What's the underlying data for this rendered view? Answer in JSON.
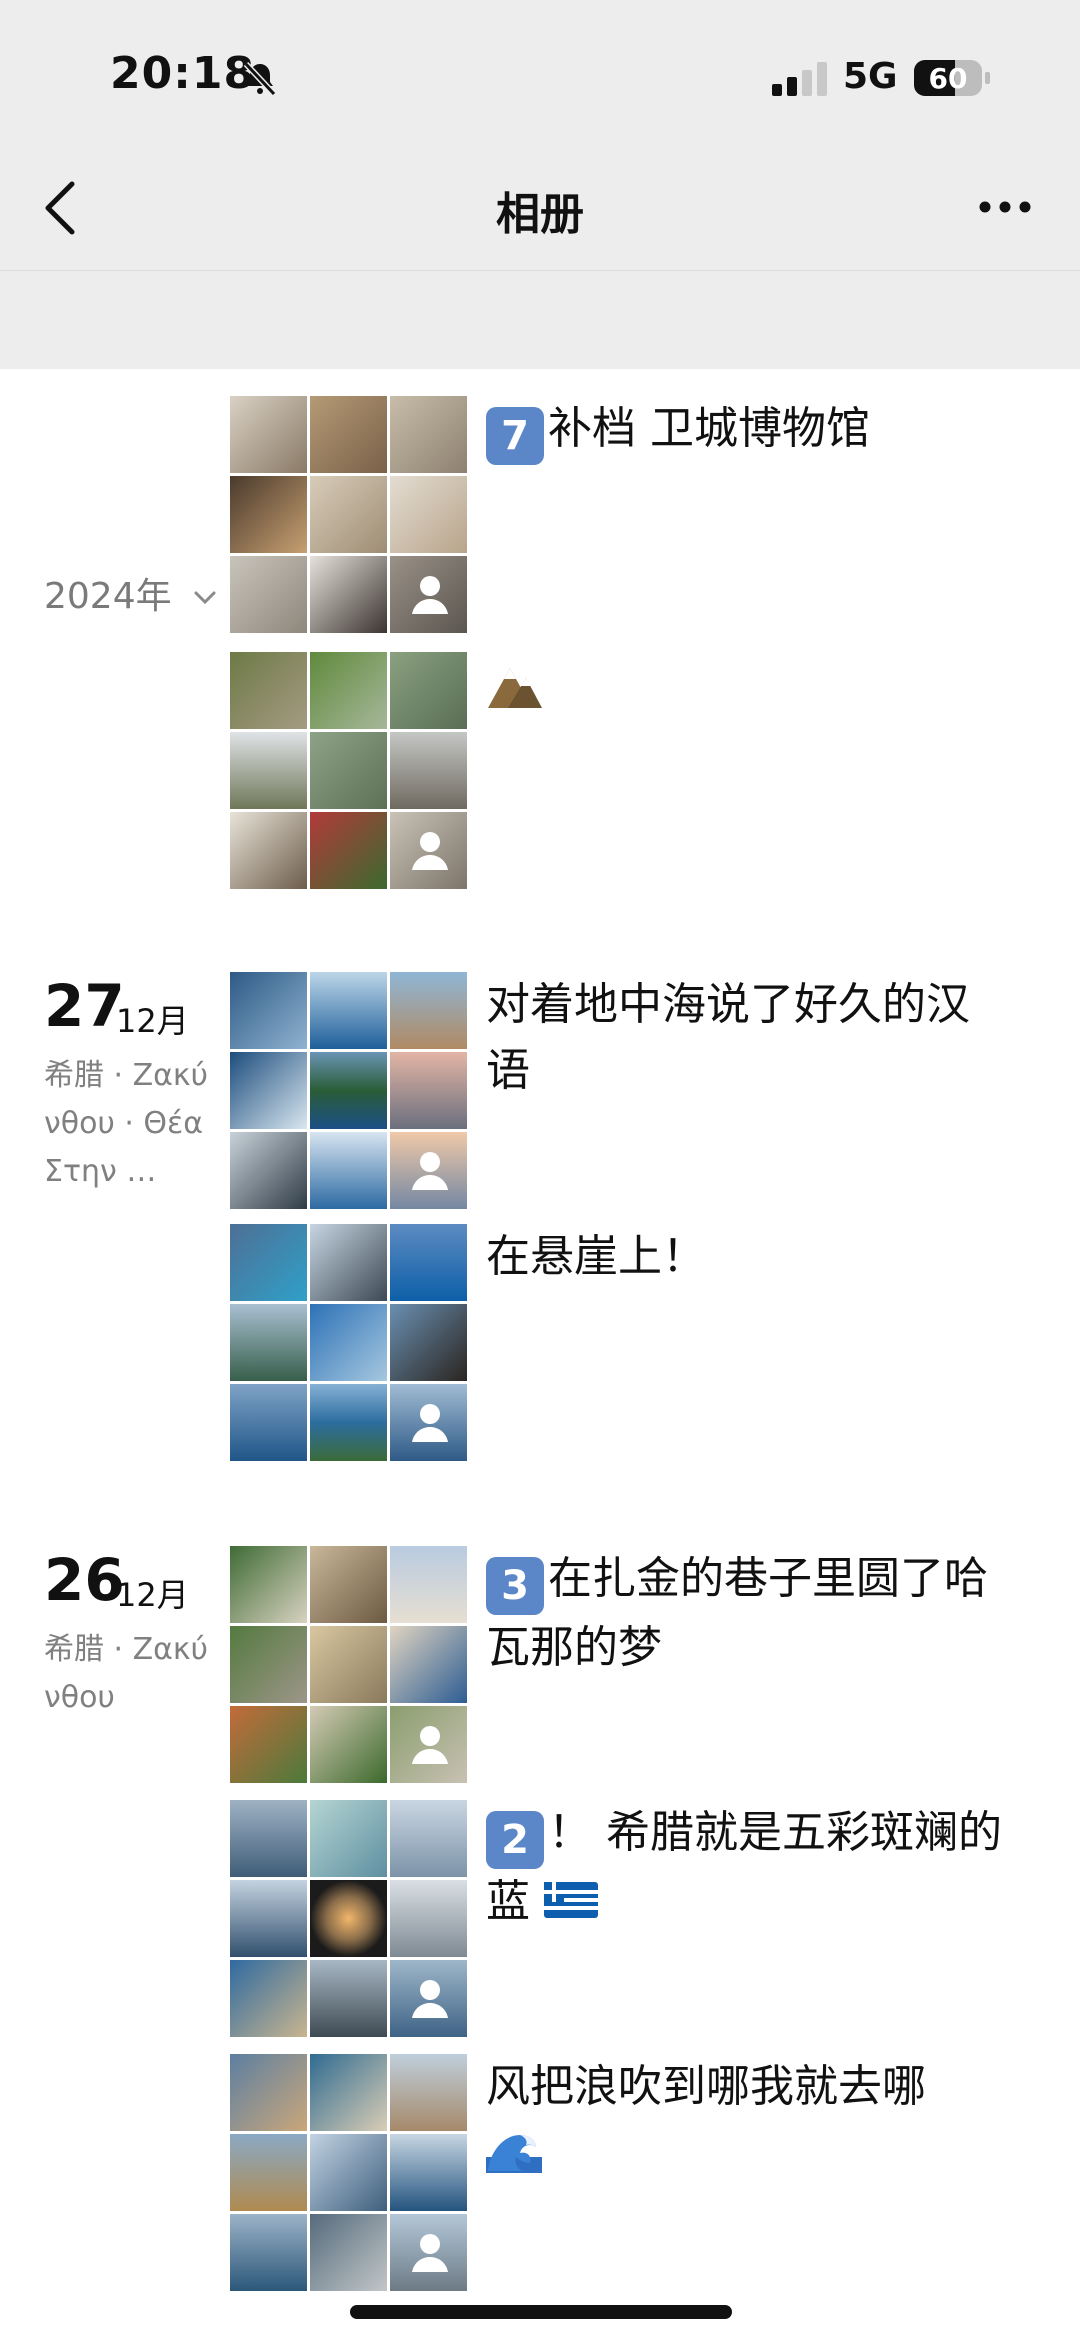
{
  "status_bar": {
    "time": "20:18",
    "network": "5G",
    "battery": "60"
  },
  "nav": {
    "title": "相册"
  },
  "year_filter": {
    "label": "2024年"
  },
  "groups": [
    {
      "posts": [
        {
          "number": "7",
          "text": "补档 卫城博物馆"
        },
        {
          "icon": "mountain-emoji"
        }
      ]
    },
    {
      "day": "27",
      "month": "12月",
      "location": "希腊 · Ζακύνθου · Θέα Στην …",
      "posts": [
        {
          "text": "对着地中海说了好久的汉语"
        },
        {
          "text": "在悬崖上！"
        }
      ]
    },
    {
      "day": "26",
      "month": "12月",
      "location": "希腊 · Ζακύνθου",
      "posts": [
        {
          "number": "3",
          "text": "在扎金的巷子里圆了哈瓦那的梦"
        },
        {
          "number": "2",
          "text": "！ 希腊就是五彩斑斓的蓝",
          "icon": "greek-flag-emoji"
        },
        {
          "text": "风把浪吹到哪我就去哪",
          "icon": "wave-emoji"
        }
      ]
    }
  ]
}
